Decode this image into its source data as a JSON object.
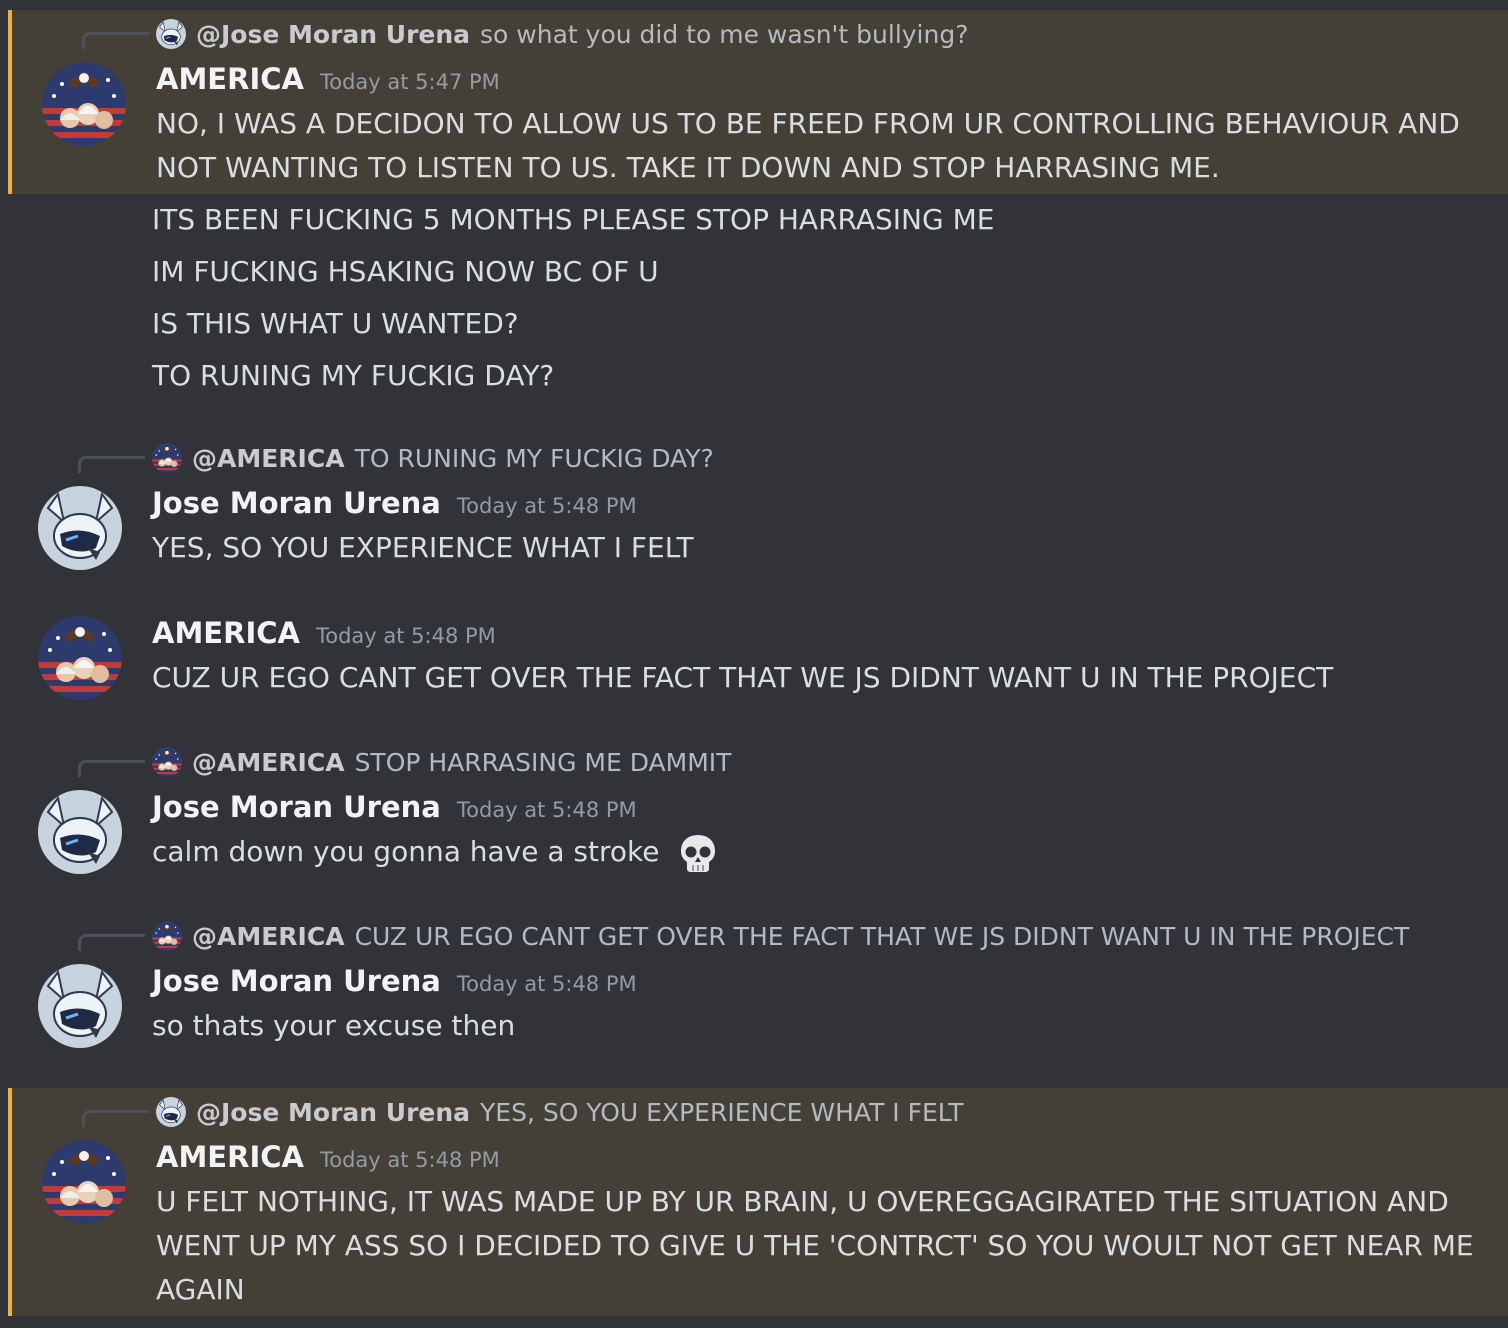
{
  "messages": [
    {
      "reply": {
        "mention": "@Jose Moran Urena",
        "text": "so what you did to me wasn't bullying?"
      },
      "author": "AMERICA",
      "timestamp": "Today at 5:47 PM",
      "lines": [
        "NO, I WAS A DECIDON TO ALLOW US TO BE FREED FROM UR CONTROLLING BEHAVIOUR AND",
        "NOT WANTING TO LISTEN TO US. TAKE IT DOWN AND STOP HARRASING ME."
      ],
      "highlighted": true
    },
    {
      "continuation": [
        "ITS BEEN FUCKING 5 MONTHS PLEASE STOP HARRASING ME",
        "IM FUCKING HSAKING NOW BC OF U",
        "IS THIS WHAT U WANTED?",
        "TO RUNING MY FUCKIG DAY?"
      ]
    },
    {
      "reply": {
        "mention": "@AMERICA",
        "text": "TO RUNING MY FUCKIG DAY?"
      },
      "author": "Jose Moran Urena",
      "timestamp": "Today at 5:48 PM",
      "lines": [
        "YES, SO YOU EXPERIENCE WHAT I FELT"
      ]
    },
    {
      "author": "AMERICA",
      "timestamp": "Today at 5:48 PM",
      "lines": [
        "CUZ UR EGO CANT GET OVER THE FACT THAT WE JS DIDNT WANT U IN THE PROJECT"
      ]
    },
    {
      "reply": {
        "mention": "@AMERICA",
        "text": "STOP HARRASING ME DAMMIT"
      },
      "author": "Jose Moran Urena",
      "timestamp": "Today at 5:48 PM",
      "lines": [
        "calm down you gonna have a stroke"
      ],
      "emoji": "skull-icon"
    },
    {
      "reply": {
        "mention": "@AMERICA",
        "text": "CUZ UR EGO CANT GET OVER THE FACT THAT WE JS DIDNT WANT U IN THE PROJECT"
      },
      "author": "Jose Moran Urena",
      "timestamp": "Today at 5:48 PM",
      "lines": [
        "so thats your excuse then"
      ]
    },
    {
      "reply": {
        "mention": "@Jose Moran Urena",
        "text": "YES, SO YOU EXPERIENCE WHAT I FELT"
      },
      "author": "AMERICA",
      "timestamp": "Today at 5:48 PM",
      "lines": [
        "U FELT NOTHING, IT WAS MADE UP BY UR BRAIN, U OVEREGGAGIRATED THE SITUATION AND",
        "WENT UP MY ASS SO I DECIDED TO GIVE U THE 'CONTRCT' SO YOU WOULT NOT GET NEAR ME",
        "AGAIN"
      ],
      "highlighted": true
    }
  ],
  "colors": {
    "background": "#313338",
    "highlight_bg": "#444037",
    "highlight_border": "#f0b232"
  }
}
